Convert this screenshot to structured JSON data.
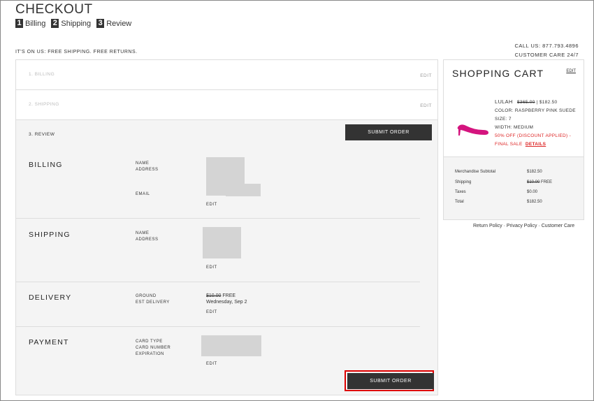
{
  "header": {
    "title": "CHECKOUT",
    "steps": [
      {
        "num": "1",
        "label": "Billing"
      },
      {
        "num": "2",
        "label": "Shipping"
      },
      {
        "num": "3",
        "label": "Review"
      }
    ],
    "promo": "IT'S ON US: FREE SHIPPING. FREE RETURNS.",
    "call_us": "CALL US: 877.793.4896",
    "customer_care": "CUSTOMER CARE 24/7"
  },
  "panels": {
    "billing_collapsed": {
      "label": "1. BILLING",
      "edit": "EDIT"
    },
    "shipping_collapsed": {
      "label": "2. SHIPPING",
      "edit": "EDIT"
    },
    "review": {
      "label": "3. REVIEW",
      "submit_label": "SUBMIT ORDER"
    }
  },
  "review": {
    "billing": {
      "title": "BILLING",
      "name_label": "NAME",
      "address_label": "ADDRESS",
      "email_label": "EMAIL",
      "edit": "EDIT"
    },
    "shipping": {
      "title": "SHIPPING",
      "name_label": "NAME",
      "address_label": "ADDRESS",
      "edit": "EDIT"
    },
    "delivery": {
      "title": "DELIVERY",
      "ground_label": "GROUND",
      "est_label": "EST DELIVERY",
      "old_price": "$10.00",
      "free": "FREE",
      "date": "Wednesday, Sep 2",
      "edit": "EDIT"
    },
    "payment": {
      "title": "PAYMENT",
      "card_type_label": "CARD TYPE",
      "card_number_label": "CARD NUMBER",
      "expiration_label": "EXPIRATION",
      "edit": "EDIT"
    },
    "submit_bottom_label": "SUBMIT ORDER"
  },
  "cart": {
    "title": "SHOPPING CART",
    "edit": "EDIT",
    "item": {
      "brand": "LULAH",
      "old_price": "$365.00",
      "separator": "|",
      "price": "$182.50",
      "color": "COLOR: RASPBERRY PINK SUEDE",
      "size": "SIZE: 7",
      "width": "WIDTH: MEDIUM",
      "discount": "50% OFF (DISCOUNT APPLIED) -",
      "final_sale": "FINAL SALE",
      "details": "DETAILS"
    },
    "totals": [
      {
        "label": "Merchandise Subtotal",
        "value": "$182.50"
      },
      {
        "label": "Shipping",
        "old_value": "$10.00",
        "value": "FREE"
      },
      {
        "label": "Taxes",
        "value": "$0.00"
      },
      {
        "label": "Total",
        "value": "$182.50"
      }
    ]
  },
  "footer": {
    "return_policy": "Return Policy",
    "privacy_policy": "Privacy Policy",
    "customer_care": "Customer Care",
    "sep": "·"
  },
  "colors": {
    "accent_dark": "#333333",
    "sale_red": "#dd2222",
    "highlight_red": "#dd0000",
    "shoe_pink": "#d4147e"
  }
}
